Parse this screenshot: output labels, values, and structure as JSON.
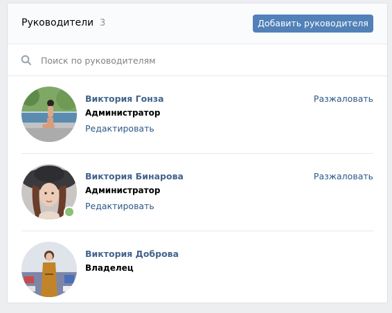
{
  "header": {
    "title": "Руководители",
    "count": "3",
    "add_button": "Добавить руководителя"
  },
  "search": {
    "placeholder": "Поиск по руководителям",
    "icon": "search-icon"
  },
  "managers": [
    {
      "name": "Виктория Гонза",
      "role": "Администратор",
      "edit": "Редактировать",
      "demote": "Разжаловать",
      "online": false
    },
    {
      "name": "Виктория Бинарова",
      "role": "Администратор",
      "edit": "Редактировать",
      "demote": "Разжаловать",
      "online": true
    },
    {
      "name": "Виктория Доброва",
      "role": "Владелец",
      "online": false
    }
  ],
  "colors": {
    "accent": "#5181b8",
    "link": "#2a5885",
    "name": "#42648b",
    "online": "#8ac176"
  }
}
